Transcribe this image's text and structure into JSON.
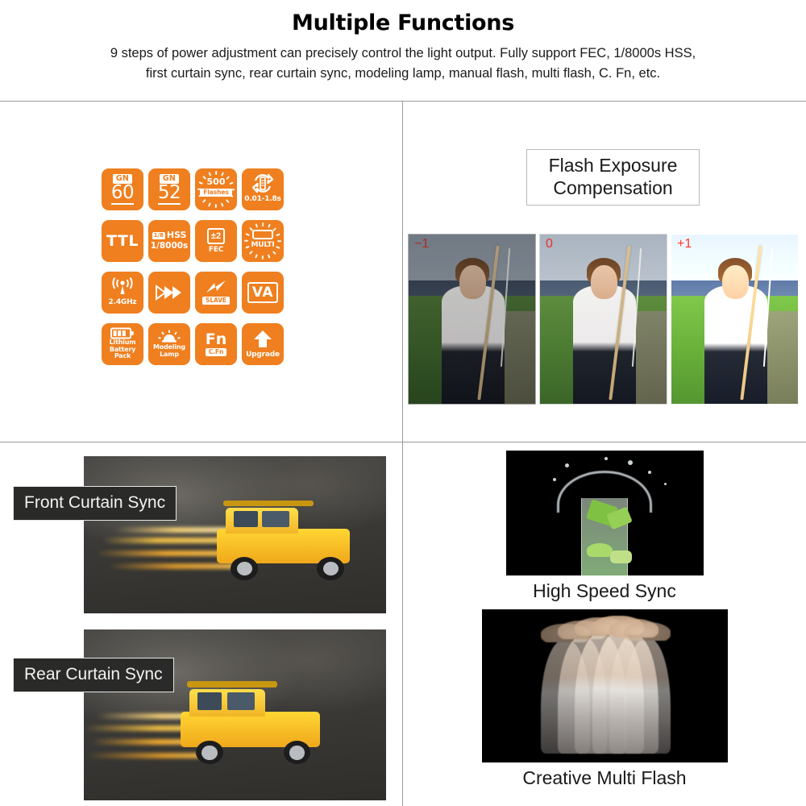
{
  "header": {
    "title": "Multiple Functions",
    "description_line1": "9 steps of power adjustment can precisely control the light output. Fully support FEC, 1/8000s HSS,",
    "description_line2": "first curtain sync, rear curtain sync, modeling lamp, manual flash, multi flash, C. Fn, etc."
  },
  "colors": {
    "accent_orange": "#ef7f1f",
    "label_red": "#e8312a",
    "divider_gray": "#9a9a9a",
    "text_dark": "#1a1a1a",
    "label_box_dark": "#2a2a28"
  },
  "features_panel": {
    "icons": [
      {
        "icon": "guide-number-60-icon",
        "tag": "GN",
        "value": "60"
      },
      {
        "icon": "guide-number-52-icon",
        "tag": "GN",
        "value": "52"
      },
      {
        "icon": "flash-count-icon",
        "value": "500",
        "badge": "Flashes"
      },
      {
        "icon": "recycle-time-icon",
        "sub": "0.01-1.8s"
      },
      {
        "icon": "ttl-icon",
        "value": "TTL"
      },
      {
        "icon": "high-speed-sync-icon",
        "flash_badge": "1/8",
        "value": "HSS",
        "sub": "1/8000s"
      },
      {
        "icon": "flash-exposure-compensation-icon",
        "symbol": "±2",
        "sub": "FEC"
      },
      {
        "icon": "multi-flash-icon",
        "sub": "MULTI"
      },
      {
        "icon": "wireless-24ghz-icon",
        "sub": "2.4GHz"
      },
      {
        "icon": "fast-forward-icon"
      },
      {
        "icon": "slave-mode-icon",
        "badge": "SLAVE"
      },
      {
        "icon": "va-icon",
        "value": "VA"
      },
      {
        "icon": "lithium-battery-icon",
        "sub_line1": "Lithium",
        "sub_line2": "Battery Pack"
      },
      {
        "icon": "modeling-lamp-icon",
        "sub_line1": "Modeling",
        "sub_line2": "Lamp"
      },
      {
        "icon": "custom-function-icon",
        "value": "Fn",
        "badge": "C.Fn"
      },
      {
        "icon": "firmware-upgrade-icon",
        "sub": "Upgrade"
      }
    ]
  },
  "exposure_panel": {
    "title_line1": "Flash Exposure",
    "title_line2": "Compensation",
    "photos": [
      {
        "label": "−1",
        "name": "exposure-photo-minus-one",
        "brightness": 0.74
      },
      {
        "label": "0",
        "name": "exposure-photo-zero",
        "brightness": 1.0
      },
      {
        "label": "+1",
        "name": "exposure-photo-plus-one",
        "brightness": 1.24
      }
    ]
  },
  "curtain_sync_panel": {
    "front_label": "Front Curtain Sync",
    "rear_label": "Rear Curtain Sync"
  },
  "demo_panel": {
    "high_speed_sync_caption": "High Speed Sync",
    "creative_multi_flash_caption": "Creative Multi Flash"
  }
}
